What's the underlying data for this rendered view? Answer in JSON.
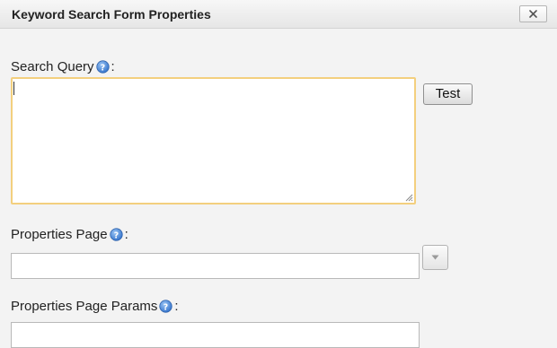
{
  "dialog": {
    "title": "Keyword Search Form Properties",
    "close_icon": "close-icon"
  },
  "search_query": {
    "label": "Search Query",
    "label_suffix": ":",
    "help_icon": "help-icon",
    "value": "",
    "test_button_label": "Test"
  },
  "properties_page": {
    "label": "Properties Page",
    "label_suffix": ":",
    "help_icon": "help-icon",
    "value": "",
    "dropdown_icon": "chevron-down-icon"
  },
  "properties_page_params": {
    "label": "Properties Page Params",
    "label_suffix": ":",
    "help_icon": "help-icon",
    "value": ""
  },
  "colors": {
    "focus_border": "#f3cf7e",
    "help_icon_blue": "#3d7fd6",
    "background": "#f3f3f3"
  }
}
